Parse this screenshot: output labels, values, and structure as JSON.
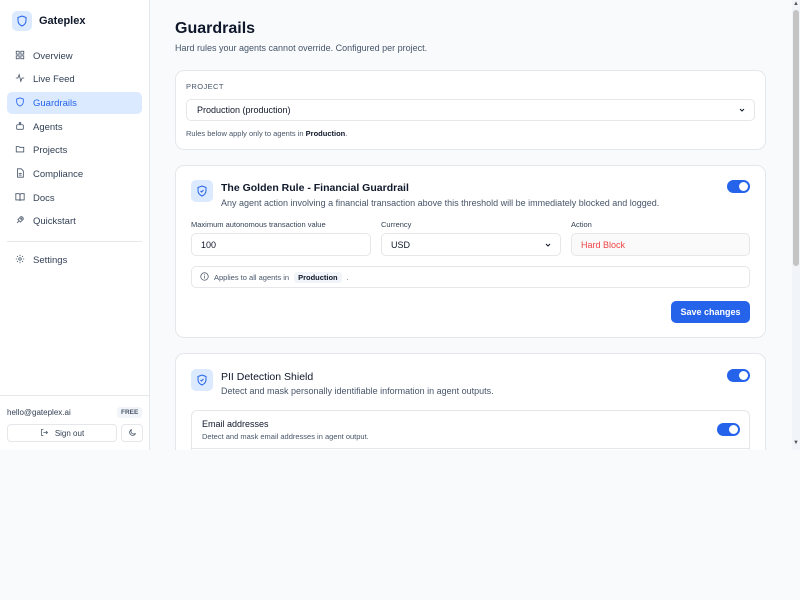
{
  "brand": {
    "name": "Gateplex",
    "logo_icon": "shield-icon"
  },
  "sidebar": {
    "items": [
      {
        "label": "Overview",
        "icon": "grid-icon",
        "active": false
      },
      {
        "label": "Live Feed",
        "icon": "activity-icon",
        "active": false
      },
      {
        "label": "Guardrails",
        "icon": "shield-icon",
        "active": true
      },
      {
        "label": "Agents",
        "icon": "bot-icon",
        "active": false
      },
      {
        "label": "Projects",
        "icon": "folder-icon",
        "active": false
      },
      {
        "label": "Compliance",
        "icon": "document-icon",
        "active": false
      },
      {
        "label": "Docs",
        "icon": "book-icon",
        "active": false
      },
      {
        "label": "Quickstart",
        "icon": "rocket-icon",
        "active": false
      }
    ],
    "settings": {
      "label": "Settings",
      "icon": "gear-icon"
    },
    "footer": {
      "email": "hello@gateplex.ai",
      "plan": "FREE",
      "signout_label": "Sign out"
    }
  },
  "page": {
    "title": "Guardrails",
    "subtitle": "Hard rules your agents cannot override. Configured per project."
  },
  "project": {
    "label": "PROJECT",
    "selected": "Production (production)",
    "note_prefix": "Rules below apply only to agents in",
    "note_project": "Production",
    "note_suffix": "."
  },
  "golden_rule": {
    "title": "The Golden Rule - Financial Guardrail",
    "description": "Any agent action involving a financial transaction above this threshold will be immediately blocked and logged.",
    "enabled": true,
    "threshold_label": "Maximum autonomous transaction value",
    "threshold_value": "100",
    "currency_label": "Currency",
    "currency_value": "USD",
    "action_label": "Action",
    "action_value": "Hard Block",
    "applies_prefix": "Applies to all agents in",
    "applies_project": "Production",
    "applies_suffix": ".",
    "save_label": "Save changes"
  },
  "pii": {
    "title": "PII Detection Shield",
    "description": "Detect and mask personally identifiable information in agent outputs.",
    "enabled": true,
    "items": [
      {
        "title": "Email addresses",
        "description": "Detect and mask email addresses in agent output.",
        "enabled": true
      }
    ]
  },
  "colors": {
    "accent": "#2563eb",
    "accent_soft": "#dbeafe",
    "danger": "#ef4444"
  }
}
